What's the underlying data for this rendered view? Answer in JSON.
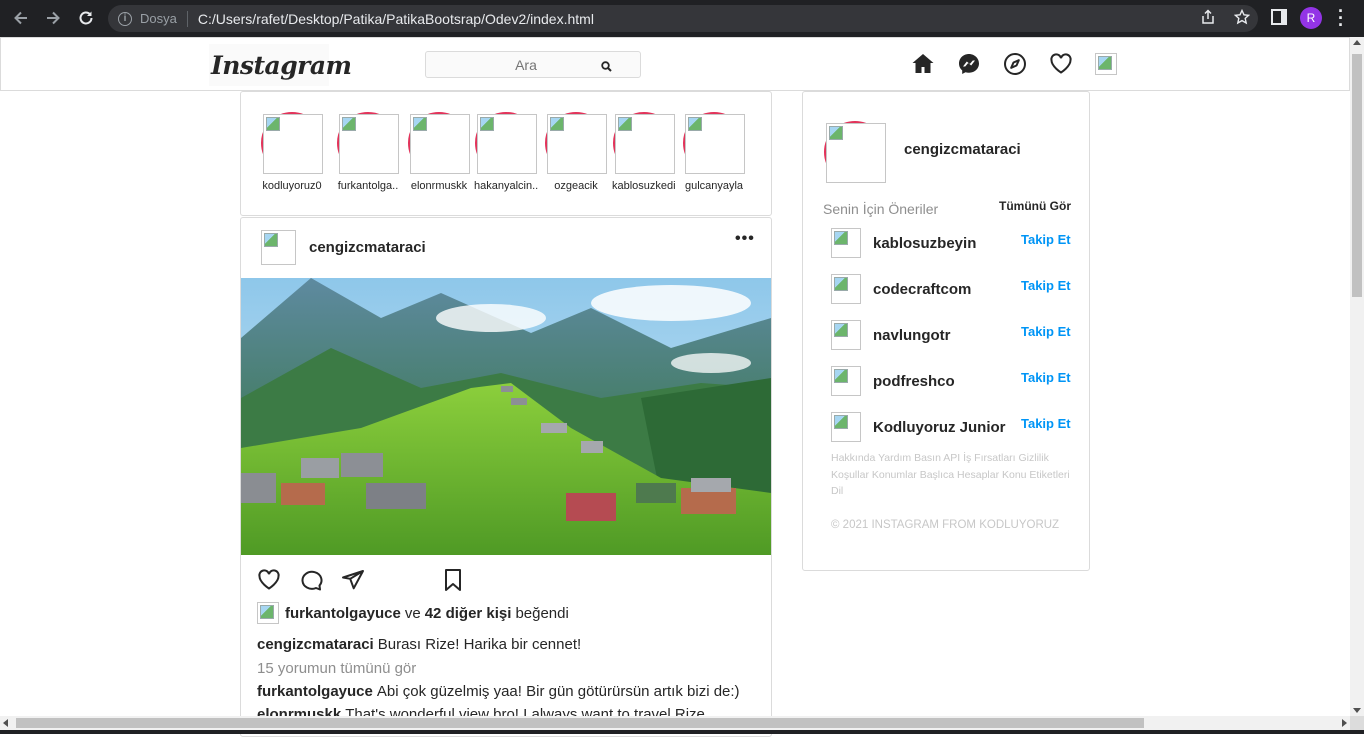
{
  "browser": {
    "scheme_label": "Dosya",
    "url": "C:/Users/rafet/Desktop/Patika/PatikaBootsrap/Odev2/index.html",
    "profile_initial": "R"
  },
  "header": {
    "logo": "Instagram",
    "search_placeholder": "Ara"
  },
  "stories": [
    {
      "username": "kodluyoruz0"
    },
    {
      "username": "furkantolga.."
    },
    {
      "username": "elonrmuskk"
    },
    {
      "username": "hakanyalcin.."
    },
    {
      "username": "ozgeacik"
    },
    {
      "username": "kablosuzkedi"
    },
    {
      "username": "gulcanyayla"
    }
  ],
  "post": {
    "author": "cengizcmataraci",
    "more": "•••",
    "likes": {
      "liker": "furkantolgayuce",
      "connector": "ve",
      "others": "42 diğer kişi",
      "suffix": "beğendi"
    },
    "caption": {
      "user": "cengizcmataraci",
      "text": "Burası Rize! Harika bir cennet!"
    },
    "view_all": "15 yorumun tümünü gör",
    "comments": [
      {
        "user": "furkantolgayuce",
        "text": "Abi çok güzelmiş yaa! Bir gün götürürsün artık bizi de:)"
      },
      {
        "user": "elonrmuskk",
        "text": "That's wonderful view bro! I always want to travel Rize."
      }
    ]
  },
  "sidebar": {
    "username": "cengizcmataraci",
    "suggestions_title": "Senin İçin Öneriler",
    "see_all": "Tümünü Gör",
    "suggestions": [
      {
        "username": "kablosuzbeyin",
        "action": "Takip Et"
      },
      {
        "username": "codecraftcom",
        "action": "Takip Et"
      },
      {
        "username": "navlungotr",
        "action": "Takip Et"
      },
      {
        "username": "podfreshco",
        "action": "Takip Et"
      },
      {
        "username": "Kodluyoruz Junior",
        "action": "Takip Et"
      }
    ],
    "footer_links": "Hakkında Yardım Basın API İş Fırsatları Gizlilik Koşullar Konumlar Başlıca Hesaplar Konu Etiketleri Dil",
    "copyright": "© 2021 INSTAGRAM FROM KODLUYORUZ"
  },
  "colors": {
    "story_ring": "#e2335a",
    "follow_blue": "#0095f6",
    "border": "#dbdbdb"
  }
}
